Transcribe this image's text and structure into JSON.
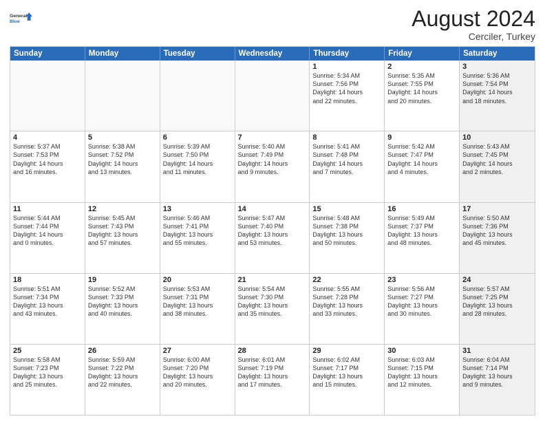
{
  "logo": {
    "general": "General",
    "blue": "Blue"
  },
  "title": "August 2024",
  "location": "Cerciler, Turkey",
  "days": [
    "Sunday",
    "Monday",
    "Tuesday",
    "Wednesday",
    "Thursday",
    "Friday",
    "Saturday"
  ],
  "weeks": [
    [
      {
        "day": "",
        "text": "",
        "empty": true
      },
      {
        "day": "",
        "text": "",
        "empty": true
      },
      {
        "day": "",
        "text": "",
        "empty": true
      },
      {
        "day": "",
        "text": "",
        "empty": true
      },
      {
        "day": "1",
        "text": "Sunrise: 5:34 AM\nSunset: 7:56 PM\nDaylight: 14 hours\nand 22 minutes."
      },
      {
        "day": "2",
        "text": "Sunrise: 5:35 AM\nSunset: 7:55 PM\nDaylight: 14 hours\nand 20 minutes."
      },
      {
        "day": "3",
        "text": "Sunrise: 5:36 AM\nSunset: 7:54 PM\nDaylight: 14 hours\nand 18 minutes.",
        "shaded": true
      }
    ],
    [
      {
        "day": "4",
        "text": "Sunrise: 5:37 AM\nSunset: 7:53 PM\nDaylight: 14 hours\nand 16 minutes."
      },
      {
        "day": "5",
        "text": "Sunrise: 5:38 AM\nSunset: 7:52 PM\nDaylight: 14 hours\nand 13 minutes."
      },
      {
        "day": "6",
        "text": "Sunrise: 5:39 AM\nSunset: 7:50 PM\nDaylight: 14 hours\nand 11 minutes."
      },
      {
        "day": "7",
        "text": "Sunrise: 5:40 AM\nSunset: 7:49 PM\nDaylight: 14 hours\nand 9 minutes."
      },
      {
        "day": "8",
        "text": "Sunrise: 5:41 AM\nSunset: 7:48 PM\nDaylight: 14 hours\nand 7 minutes."
      },
      {
        "day": "9",
        "text": "Sunrise: 5:42 AM\nSunset: 7:47 PM\nDaylight: 14 hours\nand 4 minutes."
      },
      {
        "day": "10",
        "text": "Sunrise: 5:43 AM\nSunset: 7:45 PM\nDaylight: 14 hours\nand 2 minutes.",
        "shaded": true
      }
    ],
    [
      {
        "day": "11",
        "text": "Sunrise: 5:44 AM\nSunset: 7:44 PM\nDaylight: 14 hours\nand 0 minutes."
      },
      {
        "day": "12",
        "text": "Sunrise: 5:45 AM\nSunset: 7:43 PM\nDaylight: 13 hours\nand 57 minutes."
      },
      {
        "day": "13",
        "text": "Sunrise: 5:46 AM\nSunset: 7:41 PM\nDaylight: 13 hours\nand 55 minutes."
      },
      {
        "day": "14",
        "text": "Sunrise: 5:47 AM\nSunset: 7:40 PM\nDaylight: 13 hours\nand 53 minutes."
      },
      {
        "day": "15",
        "text": "Sunrise: 5:48 AM\nSunset: 7:38 PM\nDaylight: 13 hours\nand 50 minutes."
      },
      {
        "day": "16",
        "text": "Sunrise: 5:49 AM\nSunset: 7:37 PM\nDaylight: 13 hours\nand 48 minutes."
      },
      {
        "day": "17",
        "text": "Sunrise: 5:50 AM\nSunset: 7:36 PM\nDaylight: 13 hours\nand 45 minutes.",
        "shaded": true
      }
    ],
    [
      {
        "day": "18",
        "text": "Sunrise: 5:51 AM\nSunset: 7:34 PM\nDaylight: 13 hours\nand 43 minutes."
      },
      {
        "day": "19",
        "text": "Sunrise: 5:52 AM\nSunset: 7:33 PM\nDaylight: 13 hours\nand 40 minutes."
      },
      {
        "day": "20",
        "text": "Sunrise: 5:53 AM\nSunset: 7:31 PM\nDaylight: 13 hours\nand 38 minutes."
      },
      {
        "day": "21",
        "text": "Sunrise: 5:54 AM\nSunset: 7:30 PM\nDaylight: 13 hours\nand 35 minutes."
      },
      {
        "day": "22",
        "text": "Sunrise: 5:55 AM\nSunset: 7:28 PM\nDaylight: 13 hours\nand 33 minutes."
      },
      {
        "day": "23",
        "text": "Sunrise: 5:56 AM\nSunset: 7:27 PM\nDaylight: 13 hours\nand 30 minutes."
      },
      {
        "day": "24",
        "text": "Sunrise: 5:57 AM\nSunset: 7:25 PM\nDaylight: 13 hours\nand 28 minutes.",
        "shaded": true
      }
    ],
    [
      {
        "day": "25",
        "text": "Sunrise: 5:58 AM\nSunset: 7:23 PM\nDaylight: 13 hours\nand 25 minutes."
      },
      {
        "day": "26",
        "text": "Sunrise: 5:59 AM\nSunset: 7:22 PM\nDaylight: 13 hours\nand 22 minutes."
      },
      {
        "day": "27",
        "text": "Sunrise: 6:00 AM\nSunset: 7:20 PM\nDaylight: 13 hours\nand 20 minutes."
      },
      {
        "day": "28",
        "text": "Sunrise: 6:01 AM\nSunset: 7:19 PM\nDaylight: 13 hours\nand 17 minutes."
      },
      {
        "day": "29",
        "text": "Sunrise: 6:02 AM\nSunset: 7:17 PM\nDaylight: 13 hours\nand 15 minutes."
      },
      {
        "day": "30",
        "text": "Sunrise: 6:03 AM\nSunset: 7:15 PM\nDaylight: 13 hours\nand 12 minutes."
      },
      {
        "day": "31",
        "text": "Sunrise: 6:04 AM\nSunset: 7:14 PM\nDaylight: 13 hours\nand 9 minutes.",
        "shaded": true
      }
    ]
  ]
}
